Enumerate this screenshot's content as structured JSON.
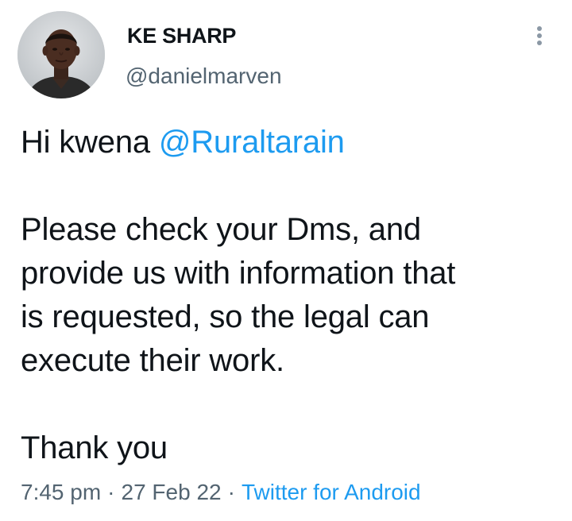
{
  "author": {
    "display_name": "KE SHARP",
    "handle": "@danielmarven",
    "avatar_icon": "profile-photo"
  },
  "menu": {
    "icon": "more-vertical-icon"
  },
  "tweet": {
    "greeting": "Hi kwena",
    "mention": "@Ruraltarain",
    "body_lines": [
      "Please check your Dms, and",
      "provide us with information that",
      "is requested, so the legal can",
      "execute their work."
    ],
    "closing": "Thank you"
  },
  "meta": {
    "time": "7:45 pm",
    "separator": "·",
    "date": "27 Feb 22",
    "source": "Twitter for Android"
  },
  "colors": {
    "accent": "#1d9bf0",
    "text": "#0f1419",
    "secondary": "#536471"
  }
}
